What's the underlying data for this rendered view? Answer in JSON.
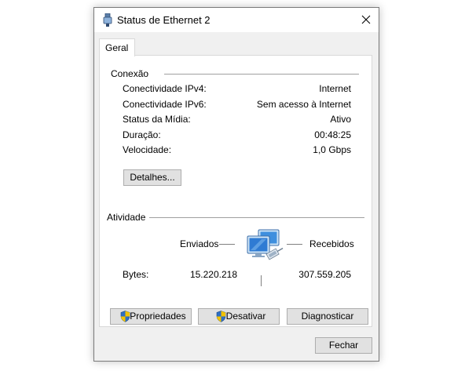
{
  "window": {
    "title": "Status de Ethernet 2"
  },
  "tabs": [
    {
      "label": "Geral"
    }
  ],
  "connection": {
    "title": "Conexão",
    "rows": [
      {
        "label": "Conectividade IPv4:",
        "value": "Internet"
      },
      {
        "label": "Conectividade IPv6:",
        "value": "Sem acesso à Internet"
      },
      {
        "label": "Status da Mídia:",
        "value": "Ativo"
      },
      {
        "label": "Duração:",
        "value": "00:48:25"
      },
      {
        "label": "Velocidade:",
        "value": "1,0 Gbps"
      }
    ],
    "details_button": "Detalhes..."
  },
  "activity": {
    "title": "Atividade",
    "sent_label": "Enviados",
    "received_label": "Recebidos",
    "bytes_label": "Bytes:",
    "bytes_sent": "15.220.218",
    "bytes_received": "307.559.205"
  },
  "buttons": {
    "properties": "Propriedades",
    "disable": "Desativar",
    "diagnose": "Diagnosticar",
    "close": "Fechar"
  },
  "icons": {
    "title": "ethernet-adapter-icon",
    "close": "close-icon",
    "network": "network-computers-icon",
    "shield": "uac-shield-icon"
  }
}
